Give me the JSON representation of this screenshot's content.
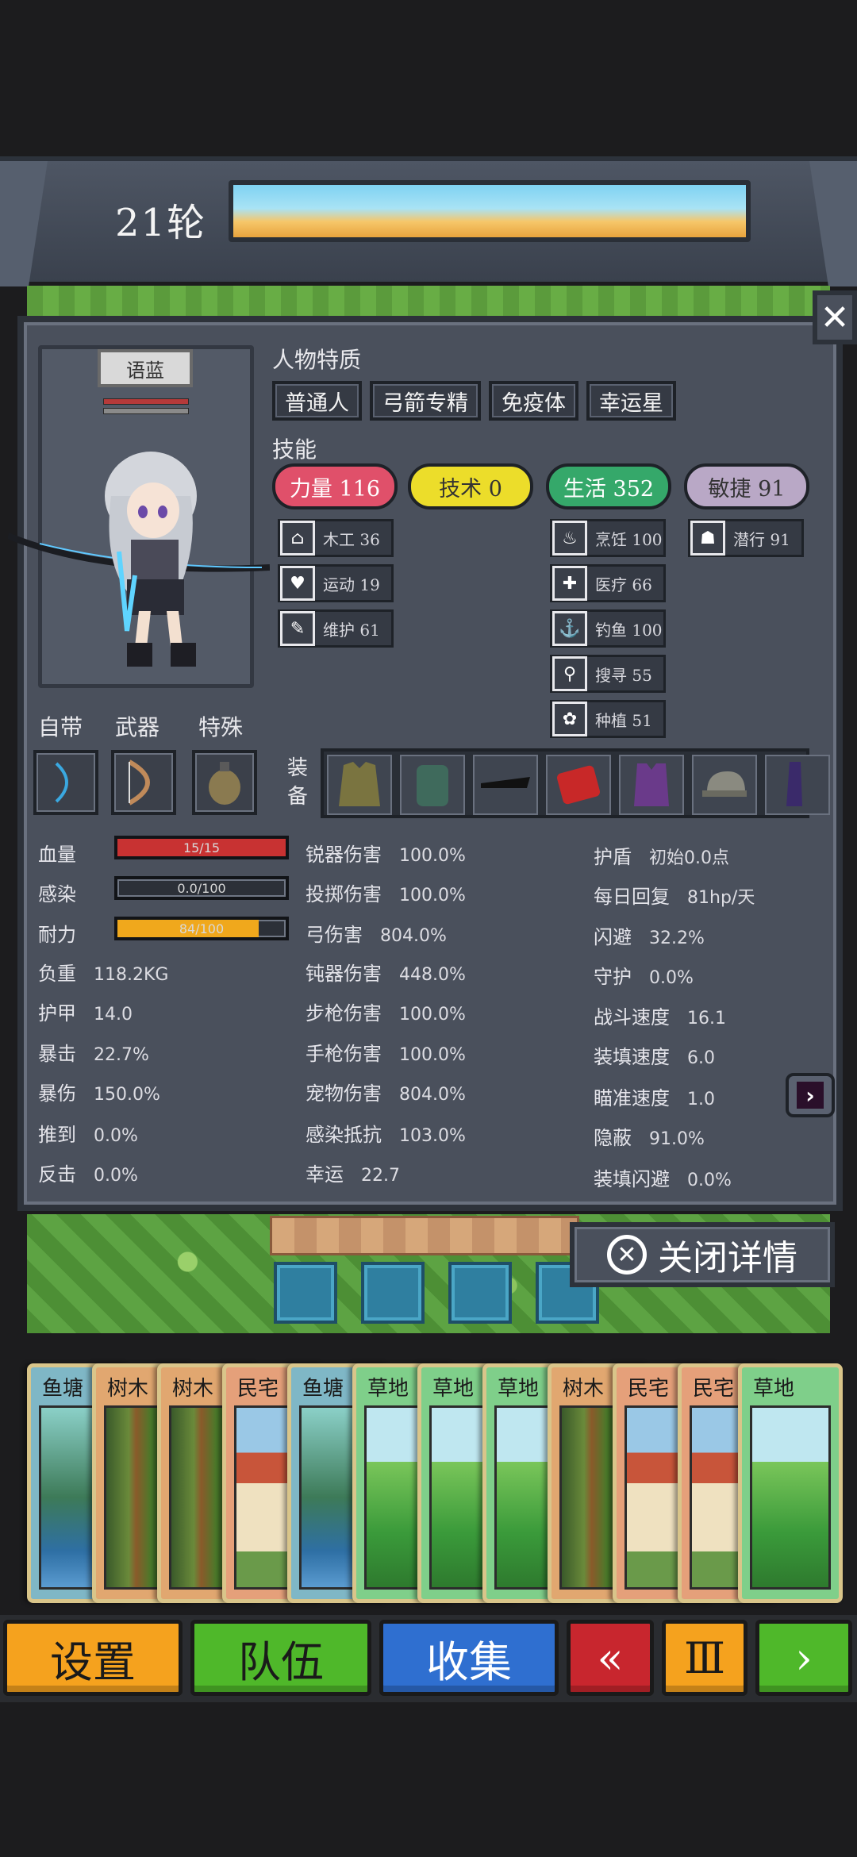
{
  "top": {
    "round": "21轮"
  },
  "panel": {
    "close_x": "✕",
    "name": "语蓝",
    "traits_title": "人物特质",
    "traits": [
      "普通人",
      "弓箭专精",
      "免疫体",
      "幸运星"
    ],
    "skills_title": "技能",
    "skills": [
      {
        "label": "力量 116",
        "color": "#e0506a"
      },
      {
        "label": "技术 0",
        "color": "#ecdd2a"
      },
      {
        "label": "生活 352",
        "color": "#35a86a"
      },
      {
        "label": "敏捷 91",
        "color": "#b9a8c6"
      }
    ],
    "sub_skills": {
      "strength": [
        {
          "icon": "house-icon",
          "glyph": "⌂",
          "label": "木工 36"
        },
        {
          "icon": "heart-icon",
          "glyph": "♥",
          "label": "运动 19"
        },
        {
          "icon": "wrench-icon",
          "glyph": "✎",
          "label": "维护 61"
        }
      ],
      "life": [
        {
          "icon": "pot-icon",
          "glyph": "♨",
          "label": "烹饪 100"
        },
        {
          "icon": "medkit-icon",
          "glyph": "✚",
          "label": "医疗 66"
        },
        {
          "icon": "fish-icon",
          "glyph": "⚓",
          "label": "钓鱼 100"
        },
        {
          "icon": "magnifier-icon",
          "glyph": "⚲",
          "label": "搜寻 55"
        },
        {
          "icon": "plant-icon",
          "glyph": "✿",
          "label": "种植 51"
        }
      ],
      "agility": [
        {
          "icon": "sneak-icon",
          "glyph": "☗",
          "label": "潜行 91"
        }
      ]
    },
    "equip_heads": [
      "自带",
      "武器",
      "特殊"
    ],
    "equip_label": "装备",
    "stats_left": [
      {
        "label": "血量",
        "bar": true,
        "text": "15/15",
        "fill": 100,
        "color": "#c83232"
      },
      {
        "label": "感染",
        "bar": true,
        "text": "0.0/100",
        "fill": 0,
        "color": "#777"
      },
      {
        "label": "耐力",
        "bar": true,
        "text": "84/100",
        "fill": 84,
        "color": "#f0a81c"
      },
      {
        "label": "负重",
        "value": "118.2KG"
      },
      {
        "label": "护甲",
        "value": "14.0"
      },
      {
        "label": "暴击",
        "value": "22.7%"
      },
      {
        "label": "暴伤",
        "value": "150.0%"
      },
      {
        "label": "推到",
        "value": "0.0%"
      },
      {
        "label": "反击",
        "value": "0.0%"
      }
    ],
    "stats_mid": [
      {
        "label": "锐器伤害",
        "value": "100.0%"
      },
      {
        "label": "投掷伤害",
        "value": "100.0%"
      },
      {
        "label": "弓伤害",
        "value": "804.0%"
      },
      {
        "label": "钝器伤害",
        "value": "448.0%"
      },
      {
        "label": "步枪伤害",
        "value": "100.0%"
      },
      {
        "label": "手枪伤害",
        "value": "100.0%"
      },
      {
        "label": "宠物伤害",
        "value": "804.0%"
      },
      {
        "label": "感染抵抗",
        "value": "103.0%"
      },
      {
        "label": "幸运",
        "value": "22.7"
      }
    ],
    "stats_right": [
      {
        "label": "护盾",
        "value": "初始0.0点"
      },
      {
        "label": "每日回复",
        "value": "81hp/天"
      },
      {
        "label": "闪避",
        "value": "32.2%"
      },
      {
        "label": "守护",
        "value": "0.0%"
      },
      {
        "label": "战斗速度",
        "value": "16.1"
      },
      {
        "label": "装填速度",
        "value": "6.0"
      },
      {
        "label": "瞄准速度",
        "value": "1.0"
      },
      {
        "label": "隐蔽",
        "value": "91.0%"
      },
      {
        "label": "装填闪避",
        "value": "0.0%"
      }
    ],
    "next": "›"
  },
  "close_detail": {
    "label": "关闭详情",
    "icon": "✕"
  },
  "cards": [
    {
      "type": "fish",
      "label": "鱼塘"
    },
    {
      "type": "tree",
      "label": "树木"
    },
    {
      "type": "tree",
      "label": "树木"
    },
    {
      "type": "house",
      "label": "民宅"
    },
    {
      "type": "fish",
      "label": "鱼塘"
    },
    {
      "type": "grass",
      "label": "草地"
    },
    {
      "type": "grass",
      "label": "草地"
    },
    {
      "type": "grass",
      "label": "草地"
    },
    {
      "type": "tree",
      "label": "树木"
    },
    {
      "type": "house",
      "label": "民宅"
    },
    {
      "type": "house",
      "label": "民宅"
    },
    {
      "type": "grass",
      "label": "草地"
    }
  ],
  "buttons": {
    "settings": "设置",
    "team": "队伍",
    "collect": "收集",
    "rewind": "«",
    "pause": "Ⅲ",
    "play": "›"
  },
  "colors": {
    "settings": "#f5a21e",
    "team": "#4fb82a",
    "collect": "#2f6fd0",
    "rewind": "#c8262e",
    "pause": "#f5a21e",
    "play": "#4fb82a"
  }
}
